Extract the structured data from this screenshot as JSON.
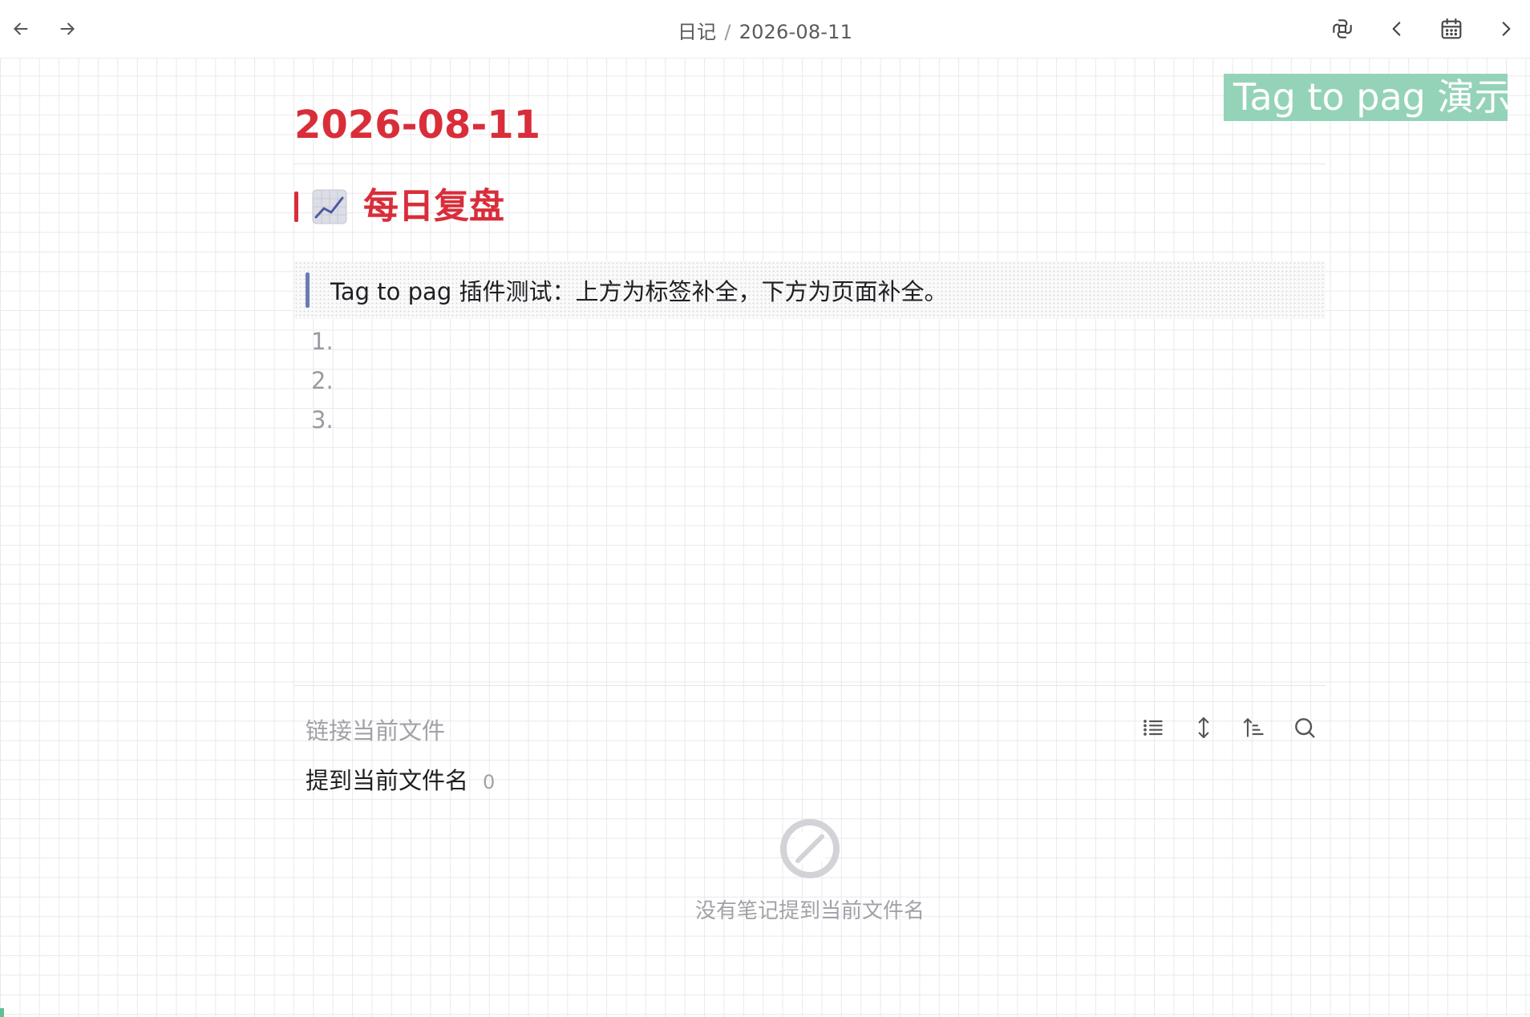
{
  "toolbar": {
    "back_icon": "arrow-left-icon",
    "forward_icon": "arrow-right-icon",
    "sync_icon": "sync-icon",
    "prev_icon": "chevron-left-icon",
    "calendar_icon": "calendar-icon",
    "next_icon": "chevron-right-icon"
  },
  "breadcrumb": {
    "folder": "日记",
    "separator": "/",
    "file": "2026-08-11"
  },
  "floating_tag": {
    "text": "Tag to pag 演示",
    "color": "#94d3b8"
  },
  "note": {
    "title": "2026-08-11",
    "heading_emoji": "chart-increasing-icon",
    "heading": "每日复盘",
    "quote": "Tag to pag 插件测试：上方为标签补全，下方为页面补全。",
    "list_items": [
      "1.",
      "2.",
      "3."
    ],
    "accent_color": "#d92d3a",
    "quote_bar_color": "#6d7bb3"
  },
  "backlinks": {
    "linked_title": "链接当前文件",
    "tools": [
      "list-icon",
      "expand-vertical-icon",
      "sort-icon",
      "search-icon"
    ],
    "mentions_label": "提到当前文件名",
    "mentions_count": "0",
    "empty_icon": "no-results-icon",
    "empty_text": "没有笔记提到当前文件名"
  }
}
